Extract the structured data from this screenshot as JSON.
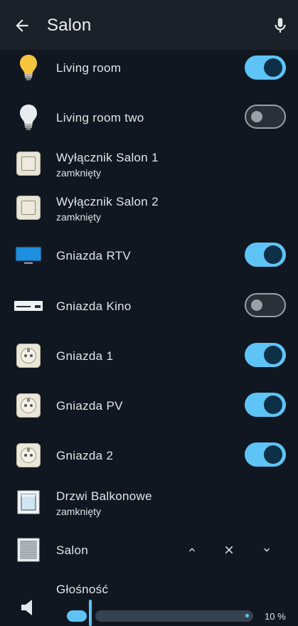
{
  "header": {
    "title": "Salon"
  },
  "entities": [
    {
      "label": "Living room",
      "icon": "bulb-on-icon",
      "state": "on"
    },
    {
      "label": "Living room two",
      "icon": "bulb-off-icon",
      "state": "off"
    },
    {
      "label": "Wyłącznik Salon 1",
      "sub": "zamknięty",
      "icon": "wall-switch-icon"
    },
    {
      "label": "Wyłącznik Salon 2",
      "sub": "zamknięty",
      "icon": "wall-switch-icon"
    },
    {
      "label": "Gniazda RTV",
      "icon": "tv-icon",
      "state": "on"
    },
    {
      "label": "Gniazda Kino",
      "icon": "media-player-icon",
      "state": "off"
    },
    {
      "label": "Gniazda 1",
      "icon": "socket-icon",
      "state": "on"
    },
    {
      "label": "Gniazda PV",
      "icon": "socket-icon",
      "state": "on"
    },
    {
      "label": "Gniazda 2",
      "icon": "socket-icon",
      "state": "on"
    },
    {
      "label": "Drzwi Balkonowe",
      "sub": "zamknięty",
      "icon": "window-icon"
    },
    {
      "label": "Salon",
      "icon": "roller-shutter-icon"
    }
  ],
  "volume": {
    "label": "Głośność",
    "value_text": "10 %",
    "value": 0.1
  },
  "colors": {
    "accent": "#5ec4f6",
    "background": "#101720",
    "header": "#1b2128"
  }
}
